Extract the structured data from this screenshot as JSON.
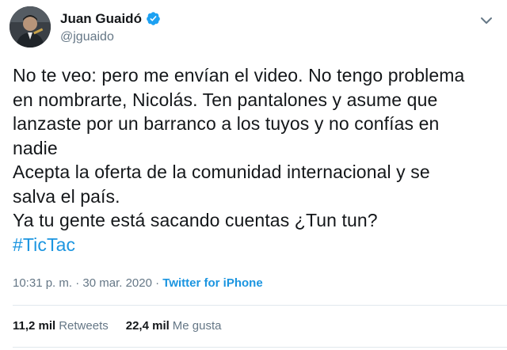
{
  "user": {
    "display_name": "Juan Guaidó",
    "handle": "@jguaido",
    "verified": true,
    "avatar_icon": "profile-photo"
  },
  "tweet": {
    "lines": [
      "No te veo: pero me envían el video. No tengo problema",
      "en nombrarte, Nicolás. Ten pantalones y asume que",
      "lanzaste por un barranco a los tuyos y no confías en",
      "nadie",
      "Acepta la oferta de la comunidad internacional y se",
      "salva el país.",
      "Ya tu gente está sacando cuentas ¿Tun tun?"
    ],
    "hashtag": "#TicTac"
  },
  "meta": {
    "time": "10:31 p. m.",
    "separator": " · ",
    "date": "30 mar. 2020",
    "separator2": " · ",
    "source": "Twitter for iPhone"
  },
  "stats": {
    "retweets_count": "11,2 mil",
    "retweets_label": "Retweets",
    "likes_count": "22,4 mil",
    "likes_label": "Me gusta"
  },
  "colors": {
    "accent": "#1b95e0",
    "text": "#14171a",
    "secondary": "#657786",
    "divider": "#e1e8ed"
  }
}
